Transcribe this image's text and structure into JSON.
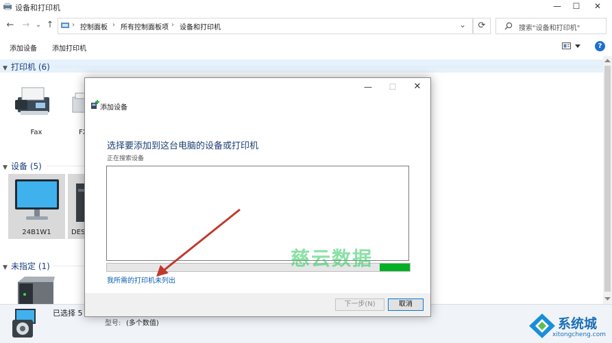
{
  "window": {
    "title": "设备和打印机",
    "controls": {
      "minimize": "—",
      "maximize": "☐",
      "close": "✕"
    }
  },
  "nav": {
    "back": "←",
    "forward": "→",
    "dropdown": "⌄",
    "up": "↑"
  },
  "address": {
    "breadcrumbs": [
      "控制面板",
      "所有控制面板项",
      "设备和打印机"
    ],
    "separator": "›",
    "dropdown": "⌄",
    "refresh": "⟳"
  },
  "search": {
    "placeholder": "搜索\"设备和打印机\""
  },
  "toolbar": {
    "add_device": "添加设备",
    "add_printer": "添加打印机",
    "help": "?"
  },
  "groups": {
    "printers": {
      "label": "打印机 (6)",
      "items": [
        "Fax",
        "FX"
      ]
    },
    "devices": {
      "label": "设备 (5)",
      "items": [
        "24B1W1",
        "DES"
      ]
    },
    "unspecified": {
      "label": "未指定 (1)"
    }
  },
  "status": {
    "selected": "已选择 5 个",
    "model_label": "型号:",
    "model_value": "(多个数值)"
  },
  "dialog": {
    "title": "添加设备",
    "heading": "选择要添加到这台电脑的设备或打印机",
    "subtext": "正在搜索设备",
    "progress_fraction": 0.1,
    "not_listed_link": "我所需的打印机未列出",
    "next_button": "下一步(N)",
    "cancel_button": "取消",
    "controls": {
      "minimize": "—",
      "maximize": "☐",
      "close": "✕"
    }
  },
  "watermark": {
    "text": "慈云数据"
  },
  "brand": {
    "name": "系统城",
    "url": "xitongcheng.com"
  },
  "colors": {
    "accent": "#1f6fd1",
    "progress": "#06b025",
    "link": "#0f5fb0",
    "group_header": "#1a3f7a"
  }
}
